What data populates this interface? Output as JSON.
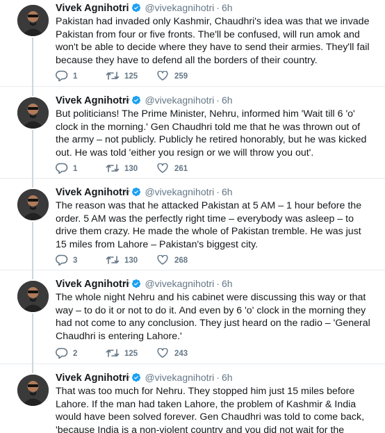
{
  "thread": {
    "tweets": [
      {
        "name": "Vivek Agnihotri",
        "handle": "@vivekagnihotri",
        "dot": "·",
        "time": "6h",
        "text": "Pakistan had invaded only Kashmir, Chaudhri's idea was that we invade Pakistan from four or five fronts. The'll be confused, will run amok and won't be able to decide where they have to send their armies. They'll fail because they have to defend all the borders of their country.",
        "replies": "1",
        "retweets": "125",
        "likes": "259"
      },
      {
        "name": "Vivek Agnihotri",
        "handle": "@vivekagnihotri",
        "dot": "·",
        "time": "6h",
        "text": "But politicians! The Prime Minister, Nehru, informed him 'Wait till 6 'o' clock in the morning.' Gen Chaudhri told me that he was thrown out of the army – not publicly. Publicly he retired honorably, but he was kicked out. He was told 'either you resign or we will throw you out'.",
        "replies": "1",
        "retweets": "130",
        "likes": "261"
      },
      {
        "name": "Vivek Agnihotri",
        "handle": "@vivekagnihotri",
        "dot": "·",
        "time": "6h",
        "text": "The reason was that he attacked Pakistan at 5 AM – 1 hour before the order. 5 AM was the perfectly right time – everybody was asleep – to drive them crazy. He made the whole of Pakistan tremble. He was just 15 miles from Lahore – Pakistan's biggest city.",
        "replies": "3",
        "retweets": "130",
        "likes": "268"
      },
      {
        "name": "Vivek Agnihotri",
        "handle": "@vivekagnihotri",
        "dot": "·",
        "time": "6h",
        "text": "The whole night Nehru and his cabinet were discussing this way or that way – to do it or not to do it. And even by 6 'o' clock in the morning they had not come to any conclusion. They just heard on the radio – 'General Chaudhri is entering Lahore.'",
        "replies": "2",
        "retweets": "125",
        "likes": "243"
      },
      {
        "name": "Vivek Agnihotri",
        "handle": "@vivekagnihotri",
        "dot": "·",
        "time": "6h",
        "text": "That was too much for Nehru. They stopped him just 15 miles before Lahore. If the man had taken Lahore, the problem of Kashmir & India would have been solved forever. Gen Chaudhri was told to come back, 'because India is a non-violent country and you did not wait for the order.'"
      }
    ]
  },
  "icons": {
    "verified": "verified-badge-icon",
    "reply": "reply-icon",
    "retweet": "retweet-icon",
    "like": "like-icon",
    "caret": "chevron-down-icon"
  },
  "colors": {
    "verified": "#1da1f2",
    "meta": "#657786",
    "text": "#14171a",
    "thread_line": "#ccd6dd",
    "divider": "#e6ecf0"
  }
}
